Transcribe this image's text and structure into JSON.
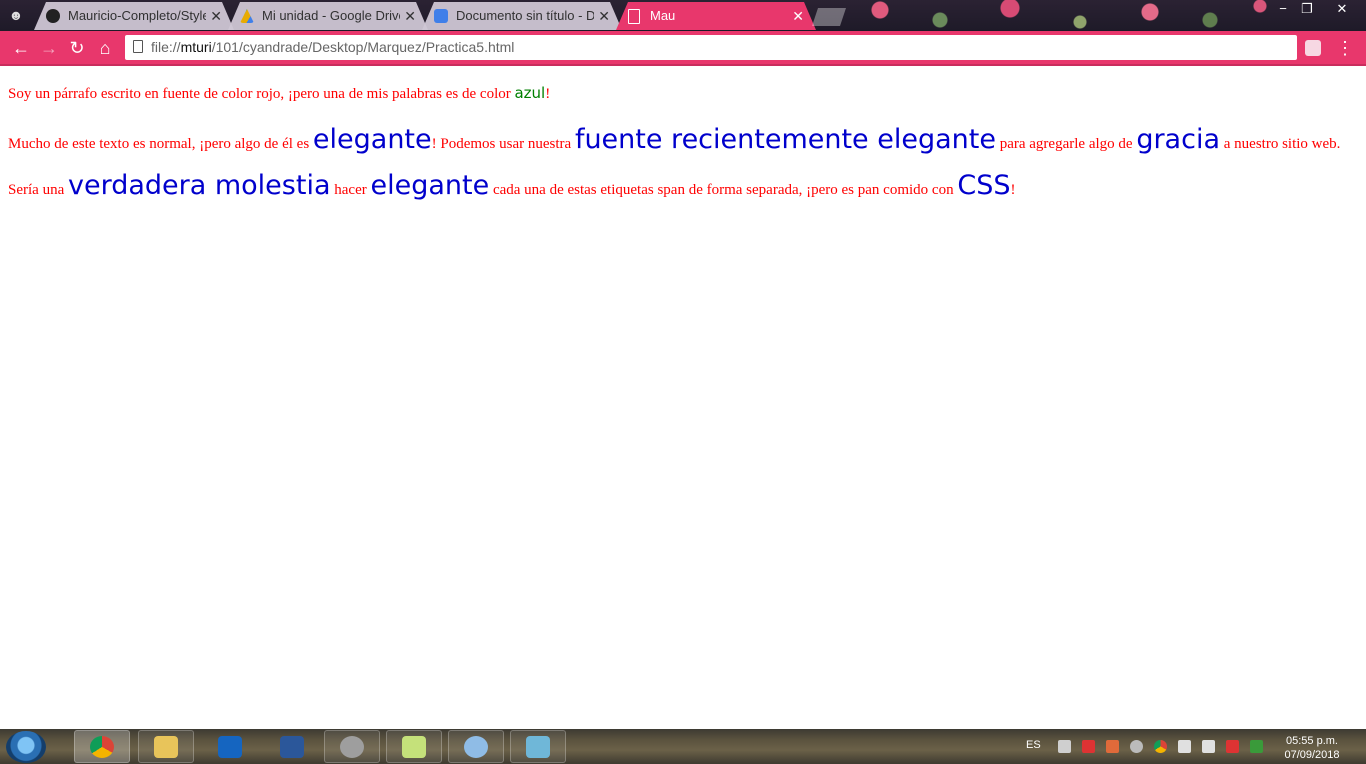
{
  "browser": {
    "tabs": [
      {
        "title": "Mauricio-Completo/Style",
        "favicon_color": "#222222",
        "active": false
      },
      {
        "title": "Mi unidad - Google Drive",
        "favicon_color": "#f4b400",
        "active": false
      },
      {
        "title": "Documento sin título - Do",
        "favicon_color": "#4285f4",
        "active": false
      },
      {
        "title": "Mau",
        "favicon_color": "#ffffff",
        "active": true
      }
    ],
    "tab_close_glyph": "✕",
    "window_controls": {
      "minimize": "−",
      "restore": "❐",
      "close": "✕"
    },
    "address": {
      "prefix": "file://",
      "host": "mturi",
      "path": "/101/cyandrade/Desktop/Marquez/Practica5.html"
    },
    "nav": {
      "back": "←",
      "forward": "→",
      "reload": "↻",
      "home": "⌂",
      "menu": "⋮"
    },
    "accent_color": "#e8376c"
  },
  "page": {
    "p1": {
      "before": "Soy un párrafo escrito en fuente de color rojo, ¡pero una de mis palabras es de color ",
      "highlight": "azul",
      "after": "!"
    },
    "p2": {
      "t1": "Mucho de este texto es normal, ¡pero algo de él es ",
      "f1": "elegante",
      "t2": "! Podemos usar nuestra ",
      "f2": "fuente recientemente elegante",
      "t3": " para agregarle algo de ",
      "f3": "gracia",
      "t4": " a nuestro sitio web. Sería una ",
      "f4": "verdadera molestia",
      "t5": " hacer ",
      "f5": "elegante",
      "t6": " cada una de estas etiquetas span de forma separada, ¡pero es pan comido con ",
      "f6": "CSS",
      "t7": "!"
    },
    "text_color": "#ff0000",
    "fancy_color": "#0000cc",
    "highlight_color": "#008000"
  },
  "taskbar": {
    "apps": [
      {
        "name": "chrome-icon",
        "color": "#db4437"
      },
      {
        "name": "file-explorer-icon",
        "color": "#e8c45a"
      },
      {
        "name": "outlook-icon",
        "color": "#1565c0"
      },
      {
        "name": "word-icon",
        "color": "#2b579a"
      },
      {
        "name": "settings-icon",
        "color": "#9e9e9e"
      },
      {
        "name": "sticky-notes-icon",
        "color": "#c5e17a"
      },
      {
        "name": "paint-icon",
        "color": "#8fbce6"
      },
      {
        "name": "app-icon",
        "color": "#6fb7d8"
      }
    ],
    "language": "ES",
    "clock": {
      "time": "05:55 p.m.",
      "date": "07/09/2018"
    }
  }
}
